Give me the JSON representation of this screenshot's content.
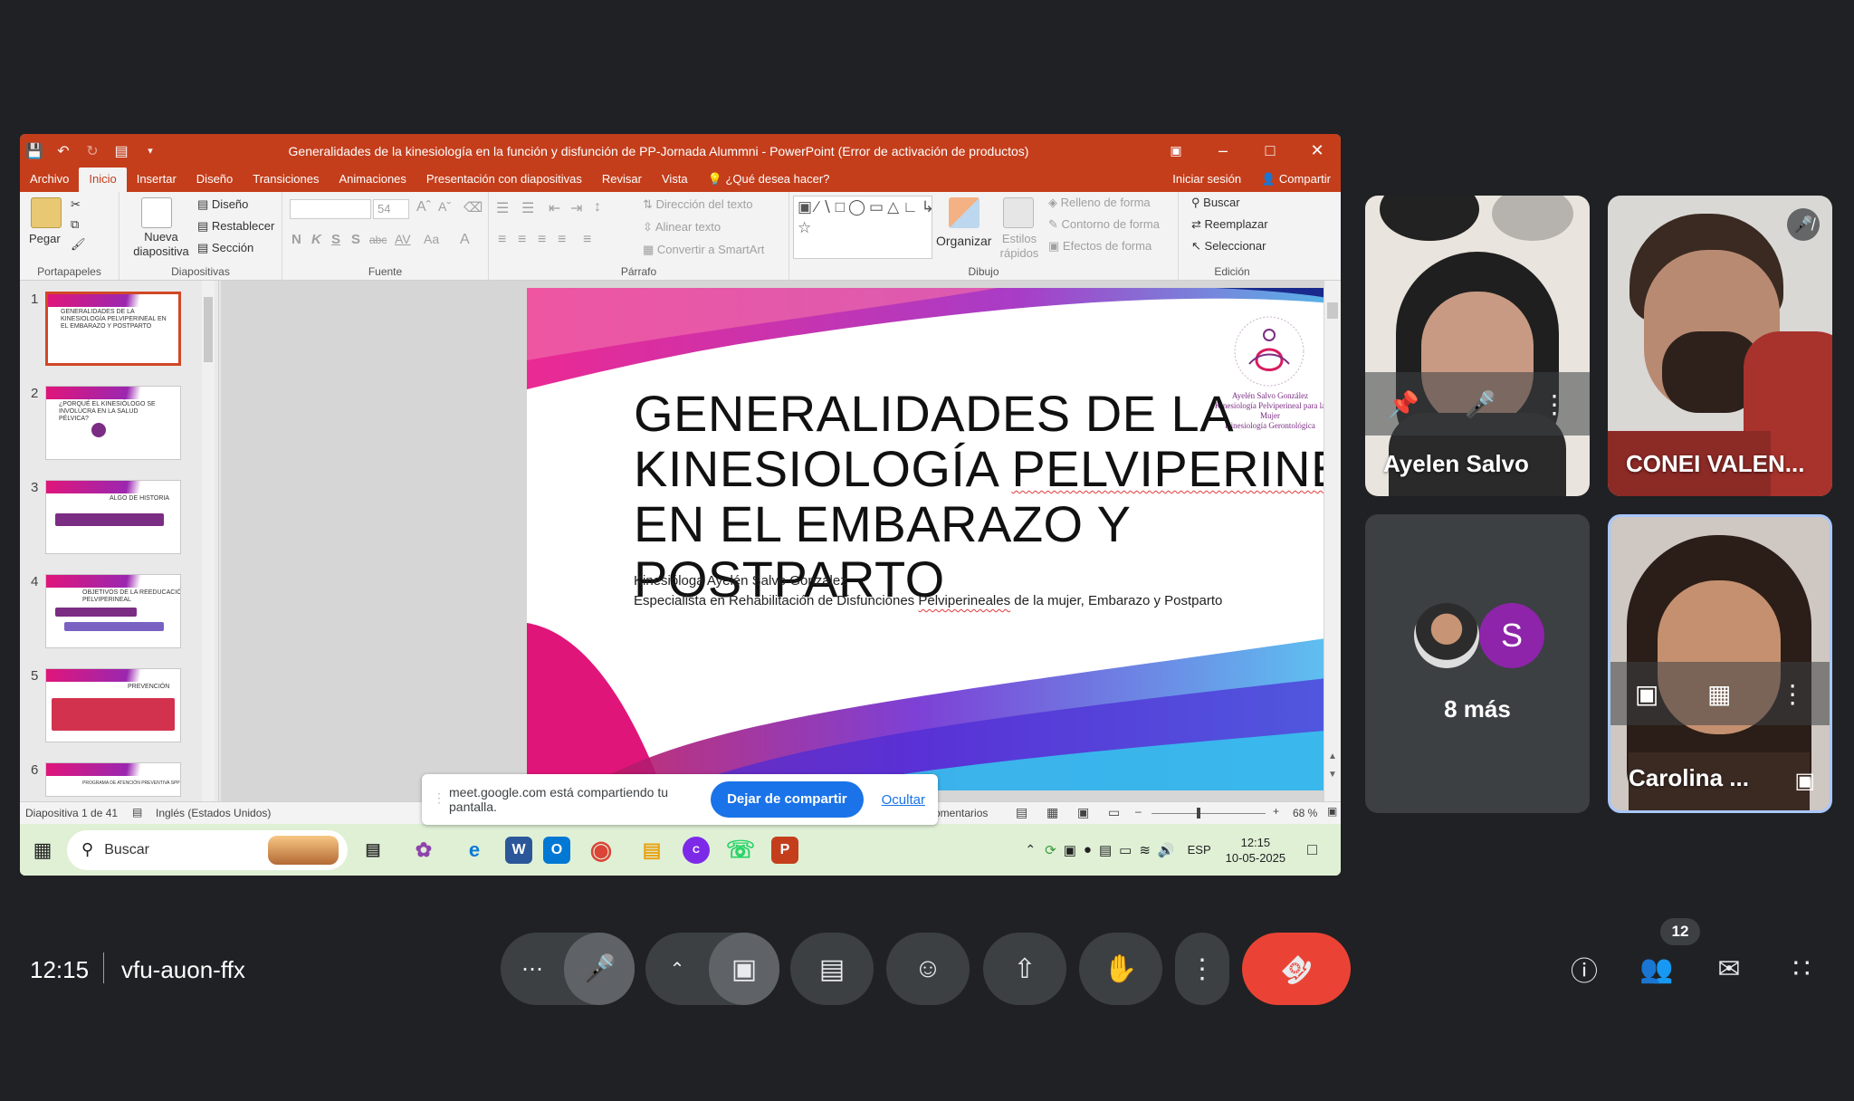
{
  "window": {
    "title": "Generalidades de la kinesiología en la función y disfunción de PP-Jornada Alummni - PowerPoint (Error de activación de productos)",
    "tabs": [
      "Archivo",
      "Inicio",
      "Insertar",
      "Diseño",
      "Transiciones",
      "Animaciones",
      "Presentación con diapositivas",
      "Revisar",
      "Vista"
    ],
    "active_tab": "Inicio",
    "tell_me": "¿Qué desea hacer?",
    "sign_in": "Iniciar sesión",
    "share": "Compartir"
  },
  "ribbon": {
    "portapapeles": {
      "label": "Portapapeles",
      "pegar": "Pegar"
    },
    "diapositivas": {
      "label": "Diapositivas",
      "nueva": "Nueva diapositiva",
      "diseno": "Diseño",
      "restablecer": "Restablecer",
      "seccion": "Sección"
    },
    "fuente": {
      "label": "Fuente",
      "size": "54",
      "bold": "N",
      "italic": "K",
      "underline": "S",
      "shadow": "S",
      "strike": "abc",
      "spacing": "AV",
      "case": "Aa",
      "color": "A"
    },
    "parrafo": {
      "label": "Párrafo",
      "direccion": "Dirección del texto",
      "alinear": "Alinear texto",
      "smartart": "Convertir a SmartArt"
    },
    "dibujo": {
      "label": "Dibujo",
      "organizar": "Organizar",
      "estilos": "Estilos rápidos",
      "relleno": "Relleno de forma",
      "contorno": "Contorno de forma",
      "efectos": "Efectos de forma"
    },
    "edicion": {
      "label": "Edición",
      "buscar": "Buscar",
      "reemplazar": "Reemplazar",
      "seleccionar": "Seleccionar"
    }
  },
  "thumbnails": [
    {
      "num": "1",
      "text": "Generalidades de la kinesiología pelviperineal en el embarazo y postparto"
    },
    {
      "num": "2",
      "text": "¿Porqué el kinesiólogo se involucra en la salud pélvica?"
    },
    {
      "num": "3",
      "text": "Algo de historia"
    },
    {
      "num": "4",
      "text": "Objetivos de la reeducación pelviperineal"
    },
    {
      "num": "5",
      "text": "Prevención"
    },
    {
      "num": "6",
      "text": "Programa de Atención Preventiva SPP"
    }
  ],
  "slide": {
    "title_lines": [
      "GENERALIDADES DE LA",
      "KINESIOLOGÍA PELVIPERINEAL",
      "EN EL EMBARAZO Y POSTPARTO"
    ],
    "author": "Kinesióloga Ayelén Salvo González",
    "subtitle_pre": "Especialista en Rehabilitación de Disfunciones ",
    "subtitle_word": "Pelviperineales",
    "subtitle_post": " de la mujer, Embarazo y Postparto",
    "logo_name": "Ayelén Salvo González",
    "logo_line2": "Kinesiología Pelviperineal para la Mujer",
    "logo_line3": "Kinesiología Gerontológica"
  },
  "statusbar": {
    "slide_info": "Diapositiva 1 de 41",
    "language": "Inglés (Estados Unidos)",
    "comments": "omentarios",
    "zoom": "68 %"
  },
  "taskbar": {
    "search_placeholder": "Buscar",
    "lang": "ESP",
    "time": "12:15",
    "date": "10-05-2025"
  },
  "share_notice": {
    "message": "meet.google.com está compartiendo tu pantalla.",
    "stop": "Dejar de compartir",
    "hide": "Ocultar"
  },
  "participants": [
    {
      "name": "Ayelen Salvo"
    },
    {
      "name": "CONEI VALEN..."
    },
    {
      "name": "8 más",
      "initial": "S"
    },
    {
      "name": "Carolina ..."
    }
  ],
  "meeting": {
    "time": "12:15",
    "code": "vfu-auon-ffx",
    "people_count": "12"
  },
  "colors": {
    "ppt_red": "#c43e1c",
    "meet_bg": "#202124",
    "end_call": "#ea4335",
    "primary_blue": "#1a73e8"
  }
}
